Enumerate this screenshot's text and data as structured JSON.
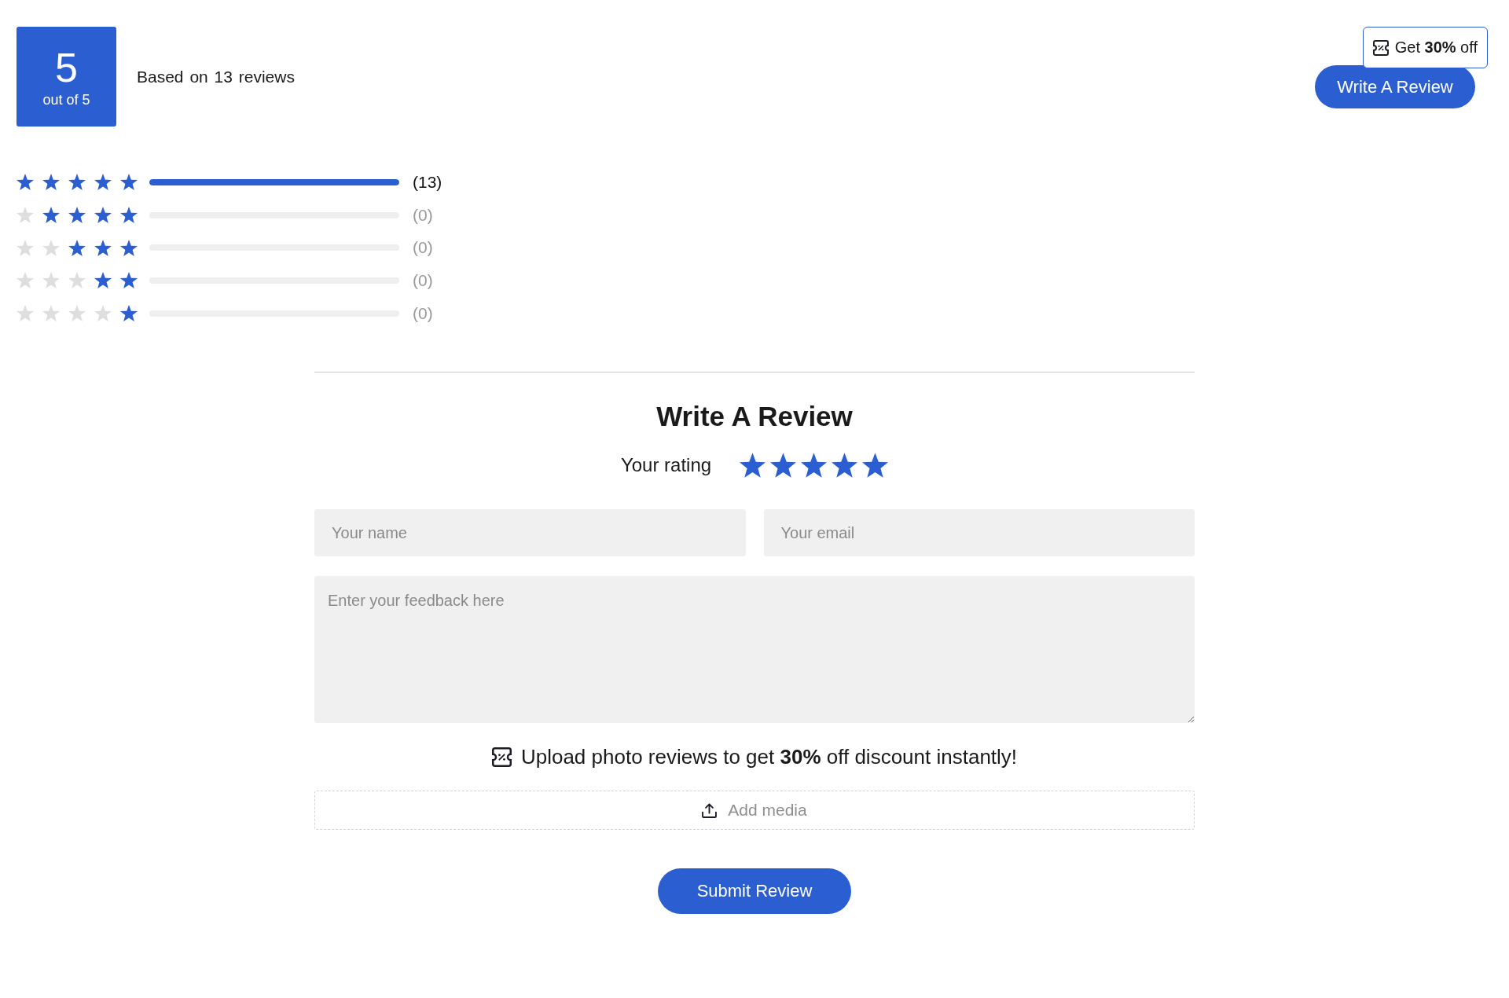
{
  "summary": {
    "score": "5",
    "score_caption": "out of 5",
    "based_on": "Based on 13 reviews"
  },
  "promo_badge": {
    "text": "Get **30%** off"
  },
  "write_review_button": {
    "label": "Write A Review"
  },
  "breakdown": [
    {
      "stars": 5,
      "level": 1,
      "count": "(13)"
    },
    {
      "stars": 4,
      "level": 0,
      "count": "(0)"
    },
    {
      "stars": 3,
      "level": 0,
      "count": "(0)"
    },
    {
      "stars": 2,
      "level": 0,
      "count": "(0)"
    },
    {
      "stars": 1,
      "level": 0,
      "count": "(0)"
    }
  ],
  "form": {
    "title": "Write A Review",
    "rating_label": "Your rating",
    "rating": {
      "stars": 5
    },
    "name_field": {
      "placeholder": "Your name"
    },
    "email_field": {
      "placeholder": "Your email"
    },
    "feedback_field": {
      "placeholder": "Enter your feedback here"
    },
    "upload_note": "Upload photo reviews to get **30%** off discount instantly!",
    "add_media_button": {
      "label": "Add media"
    },
    "submit_button": {
      "label": "Submit Review"
    }
  }
}
